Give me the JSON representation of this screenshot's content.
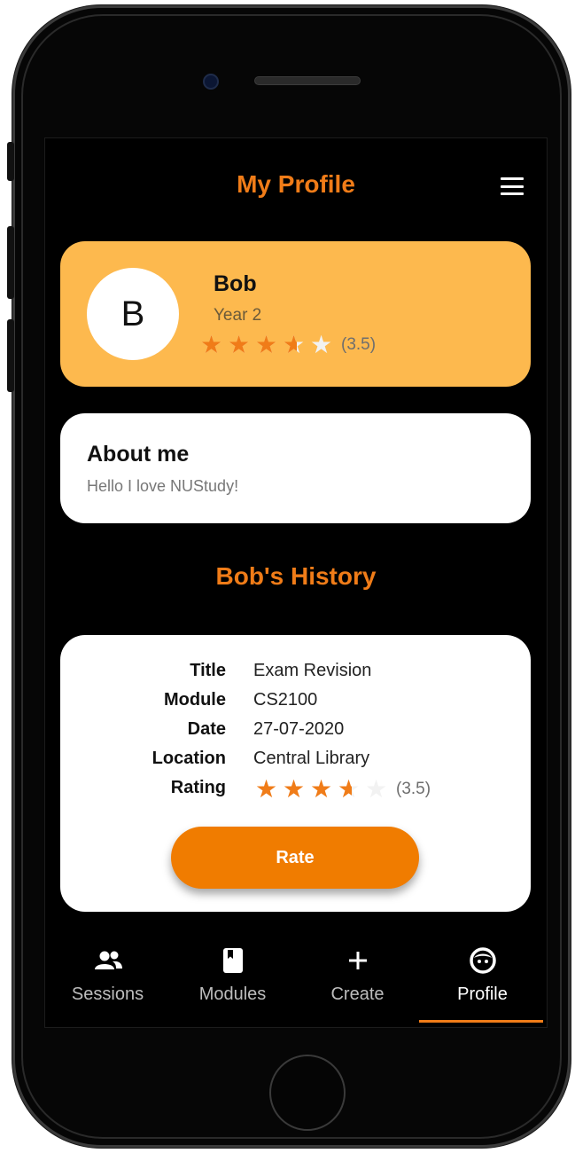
{
  "header": {
    "title": "My Profile"
  },
  "profile": {
    "initial": "B",
    "name": "Bob",
    "year": "Year 2",
    "rating": 3.5,
    "rating_text": "(3.5)"
  },
  "about": {
    "title": "About me",
    "text": "Hello I love NUStudy!"
  },
  "history": {
    "title": "Bob's History",
    "rows": [
      {
        "label": "Title",
        "value": "Exam Revision"
      },
      {
        "label": "Module",
        "value": "CS2100"
      },
      {
        "label": "Date",
        "value": "27-07-2020"
      },
      {
        "label": "Location",
        "value": "Central Library"
      },
      {
        "label": "Rating",
        "value": ""
      }
    ],
    "rating": 3.5,
    "rating_text": "(3.5)",
    "rate_label": "Rate"
  },
  "nav": {
    "items": [
      {
        "label": "Sessions",
        "icon": "people-icon"
      },
      {
        "label": "Modules",
        "icon": "book-icon"
      },
      {
        "label": "Create",
        "icon": "plus-icon"
      },
      {
        "label": "Profile",
        "icon": "face-icon"
      }
    ],
    "active": "Profile"
  },
  "colors": {
    "accent": "#f07c18",
    "profile_card": "#fdb94e",
    "rate_button": "#f07c00"
  }
}
